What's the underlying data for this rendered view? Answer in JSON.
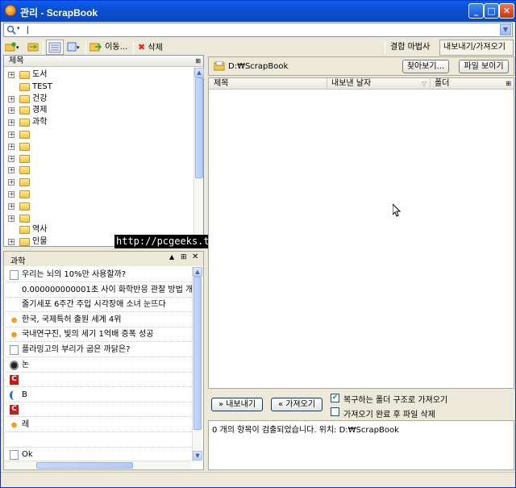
{
  "window": {
    "title": "관리 - ScrapBook"
  },
  "search": {
    "value": "|"
  },
  "toolbar": {
    "move_label": "이동...",
    "delete_label": "삭제",
    "combine_label": "결합 마법사",
    "export_import_label": "내보내기/가져오기"
  },
  "tree": {
    "header": "제목",
    "items": [
      {
        "label": "도서",
        "expandable": true
      },
      {
        "label": "TEST",
        "expandable": false
      },
      {
        "label": "건강",
        "expandable": true
      },
      {
        "label": "경제",
        "expandable": true
      },
      {
        "label": "과학",
        "expandable": true
      },
      {
        "label": "",
        "expandable": true
      },
      {
        "label": "",
        "expandable": true
      },
      {
        "label": "",
        "expandable": true
      },
      {
        "label": "",
        "expandable": true
      },
      {
        "label": "",
        "expandable": true
      },
      {
        "label": "",
        "expandable": true
      },
      {
        "label": "",
        "expandable": true
      },
      {
        "label": "",
        "expandable": true
      },
      {
        "label": "역사",
        "expandable": false
      },
      {
        "label": "인물",
        "expandable": true
      }
    ]
  },
  "watermark": "http://pcgeeks.tistory.com",
  "subpane": {
    "title": "과학",
    "items": [
      {
        "icon": "doc",
        "label": "우리는 뇌의 10%만 사용할까?"
      },
      {
        "icon": "none",
        "label": "0.000000000001초 사이 화학반응 관찰 방법 개발"
      },
      {
        "icon": "none",
        "label": "줄기세포 6주간 주입 시각장애 소녀 눈뜨다"
      },
      {
        "icon": "bird",
        "label": "한국, 국제특허 출원 세계 4위"
      },
      {
        "icon": "bird",
        "label": "국내연구진, 빛의 세기 1억배 증폭 성공"
      },
      {
        "icon": "doc",
        "label": "플라밍고의 부리가 굽은 까닭은?"
      },
      {
        "icon": "disc",
        "label": "논"
      },
      {
        "icon": "c",
        "label": ""
      },
      {
        "icon": "moon",
        "label": "B"
      },
      {
        "icon": "c",
        "label": ""
      },
      {
        "icon": "bird",
        "label": "레"
      },
      {
        "icon": "none",
        "label": ""
      },
      {
        "icon": "doc",
        "label": "Ok"
      }
    ]
  },
  "right": {
    "path": "D:₩ScrapBook",
    "browse_label": "찾아보기...",
    "show_files_label": "파일 보이기",
    "columns": [
      "제목",
      "내보낸 날자",
      "폴더"
    ],
    "export_label": "» 내보내기",
    "import_label": "« 가져오기",
    "opt_folder_label": "복구하는 폴더 구조로 가져오기",
    "opt_folder_checked": true,
    "opt_delete_label": "가져오기 완료 후 파일 삭제",
    "opt_delete_checked": false,
    "log": "0 개의 항목이 검출되었습니다. 위치: D:₩ScrapBook"
  }
}
